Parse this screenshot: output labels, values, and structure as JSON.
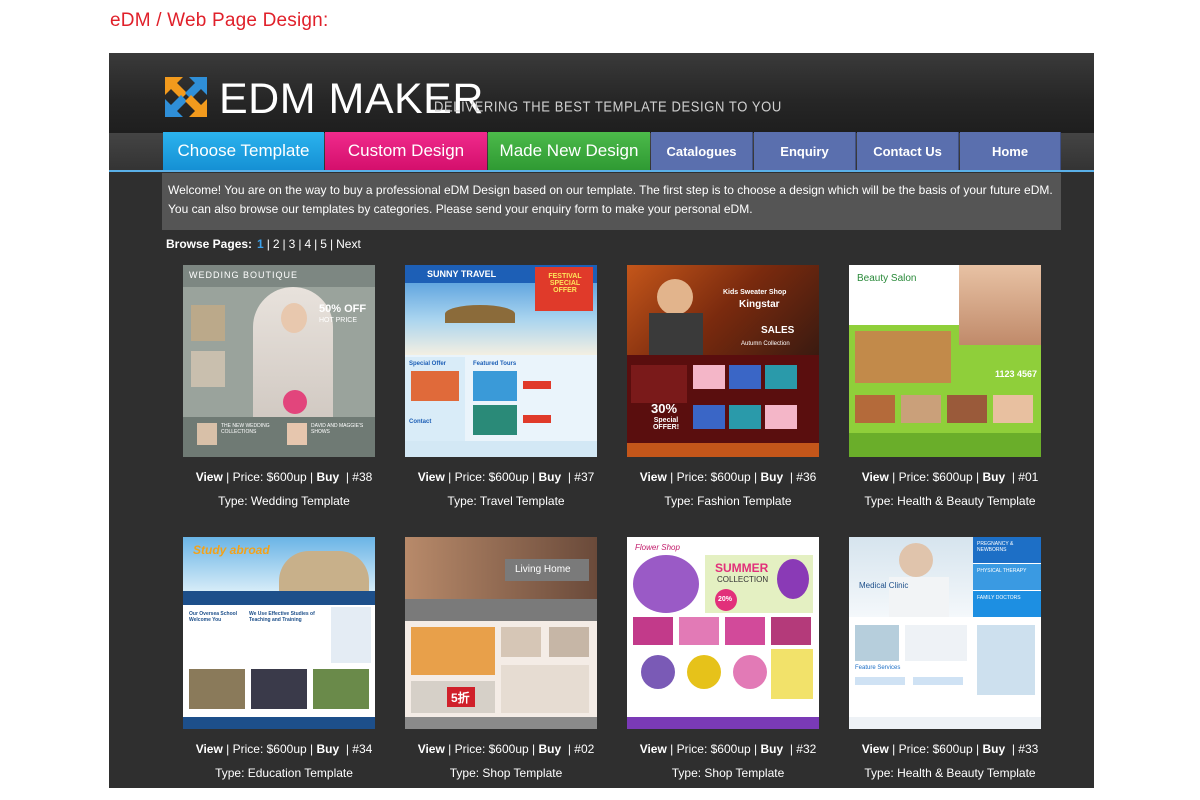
{
  "caption": "eDM / Web Page Design:",
  "header": {
    "brand": "EDM MAKER",
    "tagline": "DELIVERING THE BEST TEMPLATE DESIGN TO YOU"
  },
  "nav": {
    "choose": "Choose Template",
    "custom": "Custom Design",
    "made": "Made New Design",
    "catalogues": "Catalogues",
    "enquiry": "Enquiry",
    "contact": "Contact Us",
    "home": "Home"
  },
  "colors": {
    "choose": "#1da1e2",
    "custom": "#e6177a",
    "made": "#3aa93c",
    "nav": "#5a6fae",
    "accent": "#3aa0ea",
    "caption": "#e0202a"
  },
  "welcome": {
    "line1": "Welcome! You are on the way to buy a professional eDM Design based on our template. The first step is to choose a design which will be the basis of your future eDM.",
    "line2": "You can also browse our templates by categories. Please send your enquiry form to make your personal eDM."
  },
  "pager": {
    "label": "Browse Pages:",
    "pages": [
      "1",
      "2",
      "3",
      "4",
      "5"
    ],
    "next": "Next"
  },
  "labels": {
    "view": "View",
    "price": "Price: $600up",
    "buy": "Buy"
  },
  "templates": [
    {
      "num": "#38",
      "type": "Type: Wedding Template",
      "thumb_text": [
        "WEDDING BOUTIQUE",
        "50% OFF",
        "HOT PRICE",
        "THE NEW WEDDING COLLECTIONS",
        "DAVID AND MAGGIE'S SHOWS"
      ]
    },
    {
      "num": "#37",
      "type": "Type: Travel Template",
      "thumb_text": [
        "SUNNY TRAVEL",
        "FESTIVAL SPECIAL OFFER",
        "Special Offer",
        "Featured Tours",
        "Contact"
      ]
    },
    {
      "num": "#36",
      "type": "Type: Fashion Template",
      "thumb_text": [
        "Kids Sweater Shop",
        "Kingstar",
        "SALES",
        "Autumn Collection",
        "30%",
        "Special OFFER!"
      ]
    },
    {
      "num": "#01",
      "type": "Type: Health & Beauty Template",
      "thumb_text": [
        "Beauty Salon",
        "1123 4567"
      ]
    },
    {
      "num": "#34",
      "type": "Type: Education Template",
      "thumb_text": [
        "Study abroad",
        "Our Oversea School Welcome You",
        "We Use Effective Studies of Teaching and Training"
      ]
    },
    {
      "num": "#02",
      "type": "Type: Shop Template",
      "thumb_text": [
        "Living Home",
        "5折"
      ]
    },
    {
      "num": "#32",
      "type": "Type: Shop Template",
      "thumb_text": [
        "Flower Shop",
        "SUMMER",
        "COLLECTION",
        "20%"
      ]
    },
    {
      "num": "#33",
      "type": "Type: Health & Beauty Template",
      "thumb_text": [
        "Medical Clinic",
        "PREGNANCY & NEWBORNS",
        "PHYSICAL THERAPY",
        "FAMILY DOCTORS",
        "Feature Services"
      ]
    }
  ]
}
